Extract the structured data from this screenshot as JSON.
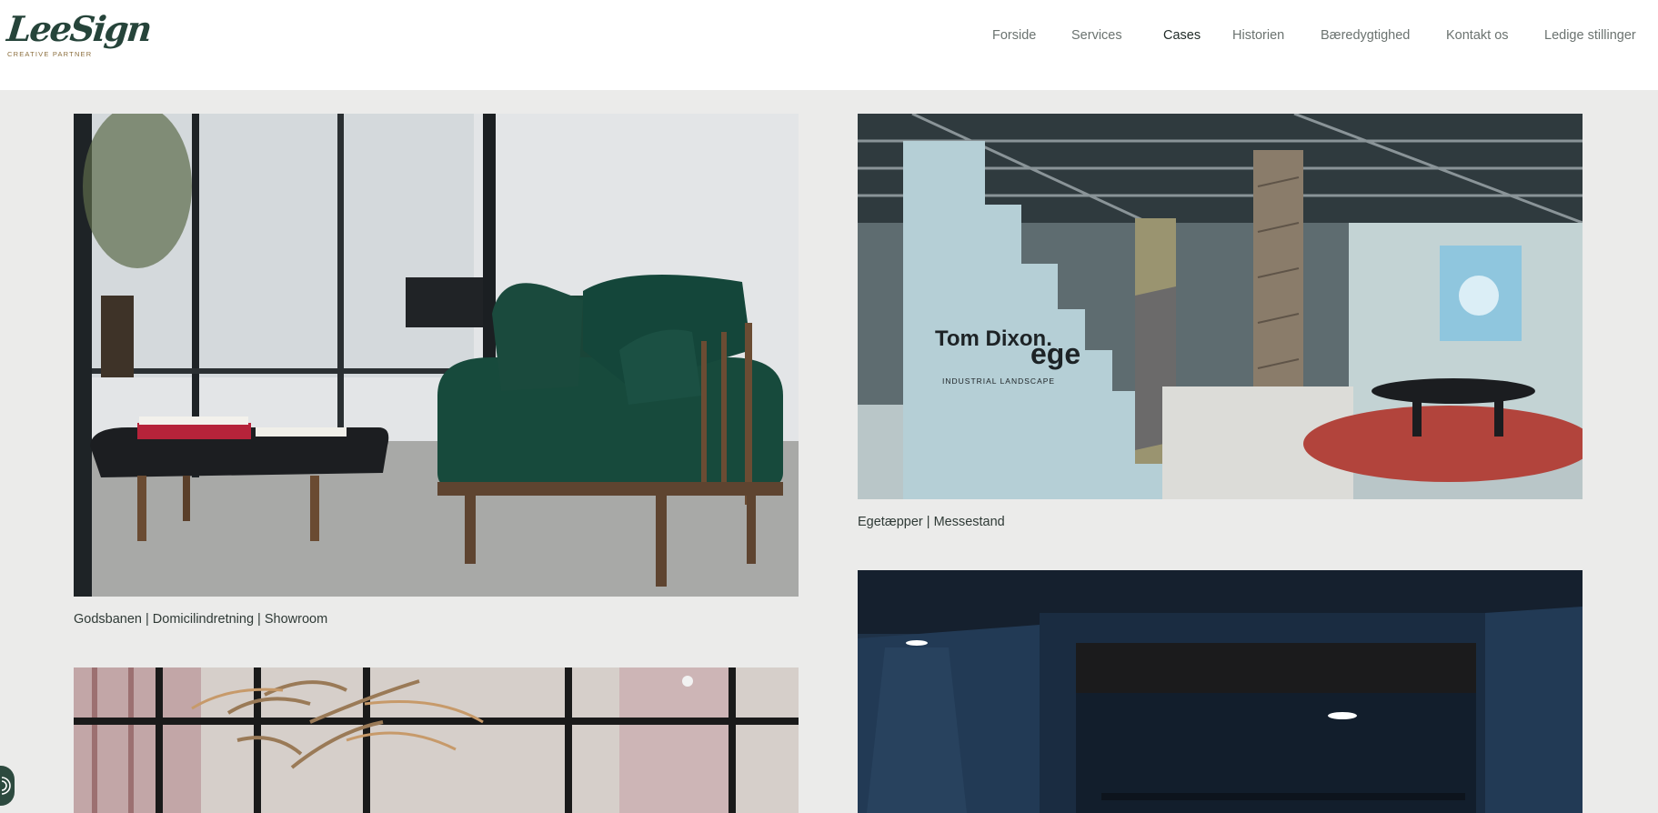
{
  "brand": {
    "name": "LeeSign",
    "tagline": "CREATIVE PARTNER"
  },
  "nav": {
    "items": [
      {
        "label": "Forside"
      },
      {
        "label": "Services"
      },
      {
        "label": "Cases"
      },
      {
        "label": "Historien"
      },
      {
        "label": "Bæredygtighed"
      },
      {
        "label": "Kontakt os"
      },
      {
        "label": "Ledige stillinger"
      }
    ],
    "active": "Cases"
  },
  "cases": [
    {
      "caption": "Godsbanen | Domicilindretning | Showroom"
    },
    {
      "caption": "Egetæpper | Messestand"
    },
    {
      "caption": ""
    },
    {
      "caption": ""
    }
  ],
  "stand": {
    "brand_left": "Tom Dixon.",
    "brand_right": "ege",
    "subtitle": "INDUSTRIAL LANDSCAPE"
  },
  "colors": {
    "brand_green": "#26443a",
    "accent_gold": "#8c6f3f",
    "nav_text": "#6b7370",
    "page_bg": "#ebebea"
  },
  "icons": {
    "accessibility": "accessibility-icon"
  }
}
